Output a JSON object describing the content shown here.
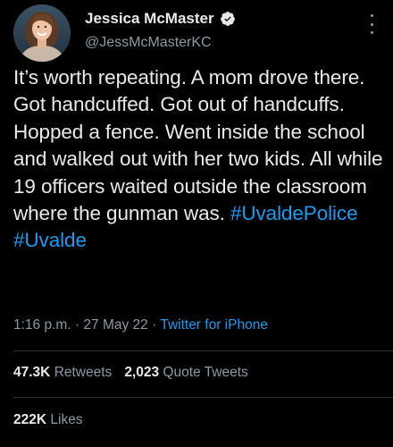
{
  "author": {
    "display_name": "Jessica McMaster",
    "handle": "@JessMcMasterKC",
    "verified": true,
    "avatar_icon": "profile-photo"
  },
  "tweet": {
    "text_plain": "It’s worth repeating. A mom drove there. Got handcuffed. Got out of handcuffs. Hopped a fence. Went inside the school and walked out with her two kids. All while 19 officers waited outside the classroom where the gunman was.",
    "hashtags": [
      "#UvaldePolice",
      "#Uvalde"
    ],
    "time": "1:16 p.m.",
    "date": "27 May 22",
    "separator": "·",
    "source": "Twitter for iPhone"
  },
  "stats": {
    "retweets_count": "47.3K",
    "retweets_label": "Retweets",
    "quotes_count": "2,023",
    "quotes_label": "Quote Tweets",
    "likes_count": "222K",
    "likes_label": "Likes"
  },
  "colors": {
    "background": "#000000",
    "text": "#e7e9ea",
    "secondary": "#8b98a5",
    "link": "#1d9bf0",
    "divider": "#2f3336"
  }
}
